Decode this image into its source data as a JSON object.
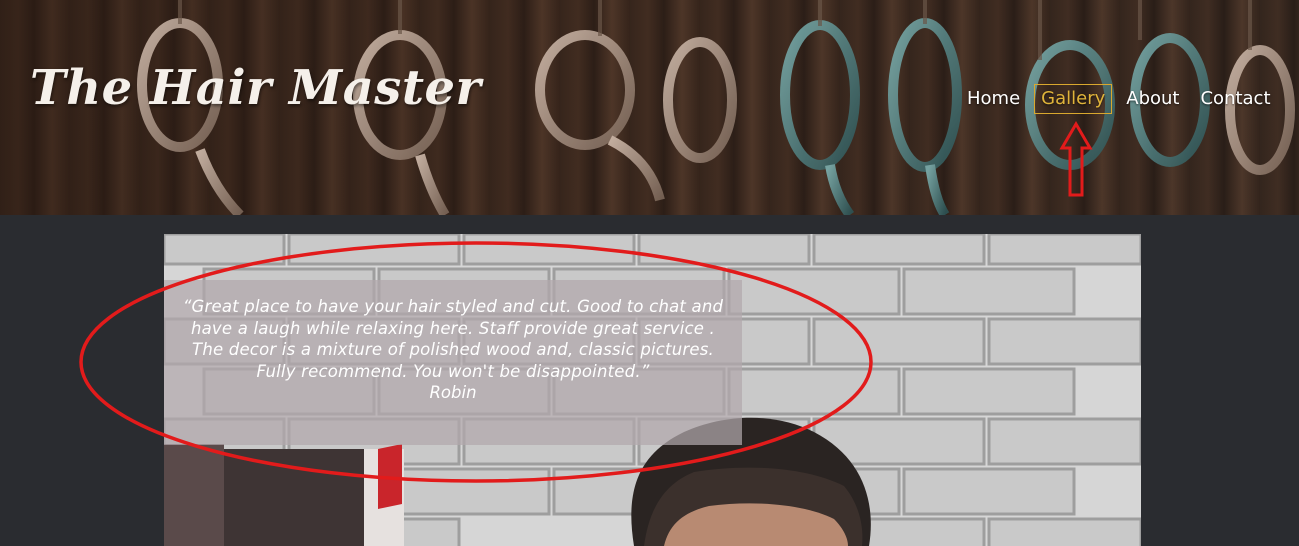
{
  "header": {
    "site_title": "The Hair Master"
  },
  "nav": {
    "items": [
      {
        "label": "Home",
        "active": false
      },
      {
        "label": "Gallery",
        "active": true
      },
      {
        "label": "About",
        "active": false
      },
      {
        "label": "Contact",
        "active": false
      }
    ]
  },
  "testimonial": {
    "quote": "“Great place to have your hair styled and cut. Good to chat and have a laugh while relaxing here. Staff provide great service . The decor is a mixture of polished wood and, classic pictures. Fully recommend. You won't be disappointed.”",
    "author": "Robin"
  },
  "colors": {
    "accent": "#e0b43a",
    "annotation": "#e21b1b",
    "page_background": "#2a2c30"
  },
  "icons": [
    "arrow-up-icon"
  ]
}
